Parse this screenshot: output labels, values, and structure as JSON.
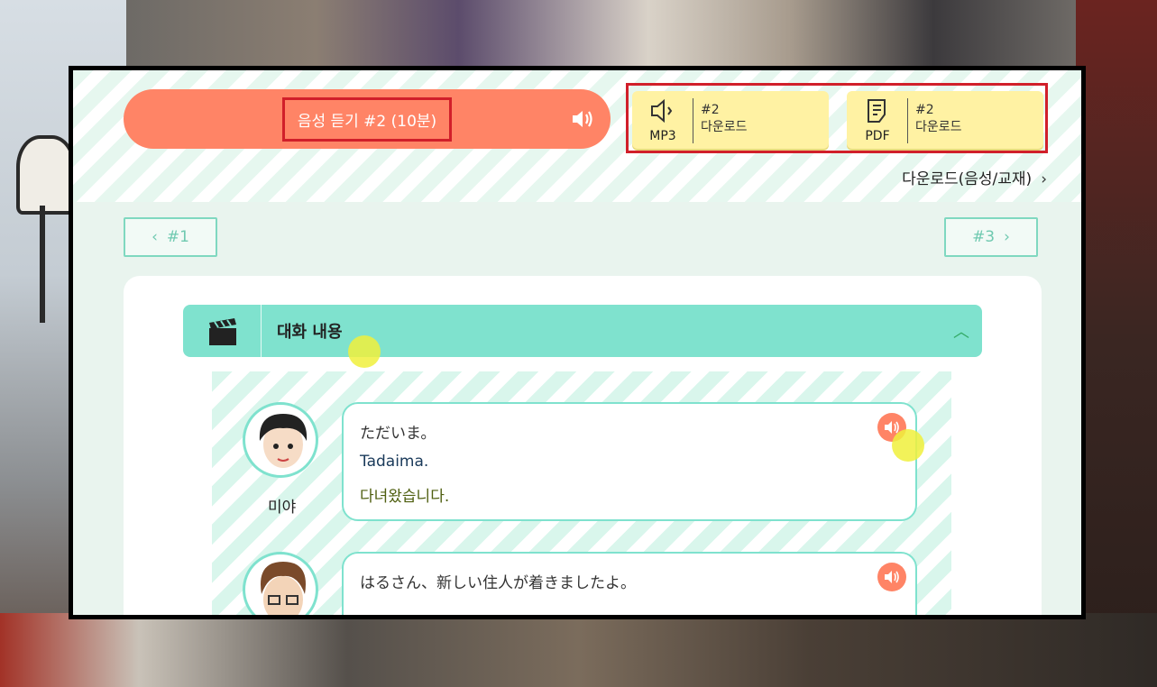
{
  "header": {
    "listen_label": "음성 듣기 #2 (10분)",
    "mp3": {
      "icon_label": "MP3",
      "num": "#2",
      "action": "다운로드"
    },
    "pdf": {
      "icon_label": "PDF",
      "num": "#2",
      "action": "다운로드"
    },
    "download_link": "다운로드(음성/교재)"
  },
  "nav": {
    "prev": "#1",
    "next": "#3"
  },
  "section": {
    "title": "대화 내용"
  },
  "dialogs": [
    {
      "speaker": "미야",
      "jp": "ただいま。",
      "romaji": "Tadaima.",
      "ko": "다녀왔습니다."
    },
    {
      "speaker": "",
      "jp": "はるさん、新しい住人が着きましたよ。",
      "romaji": "",
      "ko": ""
    }
  ],
  "colors": {
    "accent": "#ff8466",
    "mint": "#7fe2ce",
    "yellow": "#fff2a3",
    "highlight": "#d11f2a"
  }
}
